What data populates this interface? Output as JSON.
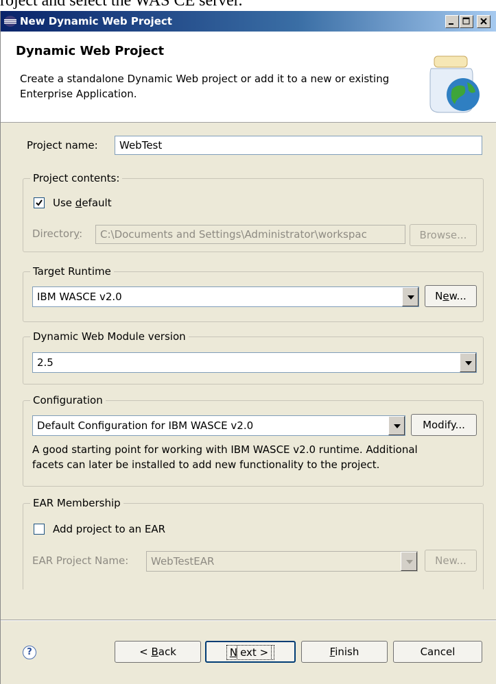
{
  "doc_caption": "roject and select the WAS CE server.",
  "window": {
    "title": "New Dynamic Web Project"
  },
  "header": {
    "title": "Dynamic Web Project",
    "description": "Create a standalone Dynamic Web project or add it to a new or existing Enterprise Application."
  },
  "project_name": {
    "label": "Project name:",
    "value": "WebTest"
  },
  "project_contents": {
    "label": "Project contents:",
    "use_default": {
      "pre": "Use ",
      "accel": "d",
      "post": "efault",
      "checked": true
    },
    "directory": {
      "pre": "Director",
      "accel": "y",
      "post": ":",
      "value": "C:\\Documents and Settings\\Administrator\\workspac"
    },
    "browse_label": "Browse..."
  },
  "target_runtime": {
    "label": "Target Runtime",
    "selected": "IBM WASCE v2.0",
    "new_button": {
      "pre": "N",
      "accel": "e",
      "post": "w..."
    }
  },
  "web_module": {
    "label": "Dynamic Web Module version",
    "selected": "2.5"
  },
  "configuration": {
    "label": "Configuration",
    "selected": "Default Configuration for IBM WASCE v2.0",
    "modify_label": "Modify...",
    "description_line1": "A good starting point for working with IBM WASCE v2.0 runtime. Additional",
    "description_line2": "facets can later be installed to add new functionality to the project."
  },
  "ear_membership": {
    "label": "EAR Membership",
    "add_to_ear_label": "Add project to an EAR",
    "add_to_ear_checked": false,
    "ear_project_name_label": "EAR Project Name:",
    "ear_project_name_value": "WebTestEAR",
    "new_label": "New..."
  },
  "footer": {
    "help_glyph": "?",
    "back": {
      "pre": "< ",
      "accel": "B",
      "post": "ack"
    },
    "next": {
      "pre": "",
      "accel": "N",
      "post": "ext >"
    },
    "finish": {
      "pre": "",
      "accel": "F",
      "post": "inish"
    },
    "cancel": "Cancel"
  },
  "icons": [
    "eclipse-logo-icon",
    "minimize-icon",
    "maximize-icon",
    "close-icon",
    "web-project-jar-icon",
    "help-icon",
    "dropdown-arrow-icon",
    "checkmark-icon"
  ]
}
